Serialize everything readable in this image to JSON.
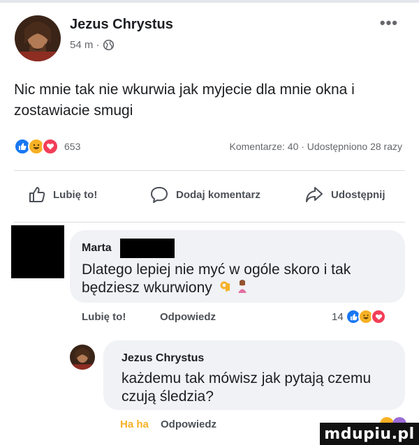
{
  "post": {
    "author": "Jezus Chrystus",
    "time": "54 m ·",
    "more": "•••",
    "text": "Nic mnie tak nie wkurwia jak myjecie dla mnie okna i zostawiacie smugi",
    "reaction_count": "653",
    "stats": "Komentarze: 40 · Udostępniono 28 razy"
  },
  "actions": {
    "like": "Lubię to!",
    "comment": "Dodaj komentarz",
    "share": "Udostępnij"
  },
  "comments": [
    {
      "name": "Marta",
      "text": "Dlatego lepiej nie myć w ogóle skoro i tak będziesz wkurwiony",
      "like": "Lubię to!",
      "reply": "Odpowiedz",
      "reaction_count": "14"
    },
    {
      "name": "Jezus Chrystus",
      "text": "każdemu tak mówisz jak pytają czemu czują śledzia?",
      "like": "Ha ha",
      "reply": "Odpowiedz"
    }
  ],
  "watermark": "mdupiu.pl",
  "colors": {
    "like_blue": "#1877f2",
    "haha_yellow": "#f7b125",
    "love_red": "#f33e58",
    "haha_label": "#f7b125"
  }
}
